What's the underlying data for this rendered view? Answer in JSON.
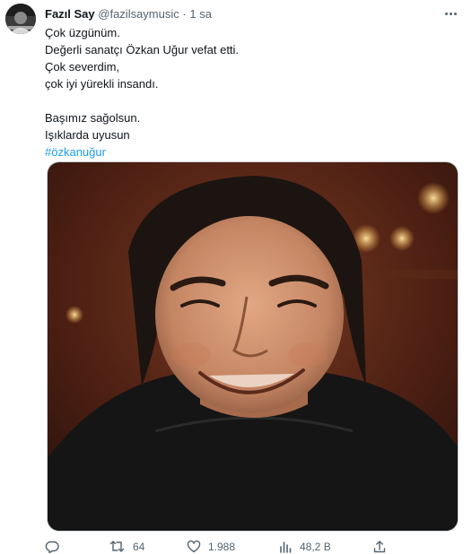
{
  "user": {
    "name": "Fazıl Say",
    "handle": "@fazilsaymusic",
    "separator": "·",
    "time": "1 sa"
  },
  "tweet": {
    "lines": [
      "Çok üzgünüm.",
      "Değerli sanatçı Özkan Uğur vefat etti.",
      "Çok severdim,",
      "çok iyi yürekli insandı.",
      "",
      "Başımız sağolsun.",
      "Işıklarda uyusun"
    ],
    "hashtag": "#özkanuğur"
  },
  "actions": {
    "reply_count": "",
    "retweet_count": "64",
    "like_count": "1.988",
    "view_count": "48,2 B"
  },
  "icons": {
    "more": "more-icon",
    "reply": "reply-icon",
    "retweet": "retweet-icon",
    "like": "heart-icon",
    "views": "views-icon",
    "share": "share-icon"
  },
  "colors": {
    "text": "#0f1419",
    "secondary": "#536471",
    "link": "#1d9bf0"
  }
}
